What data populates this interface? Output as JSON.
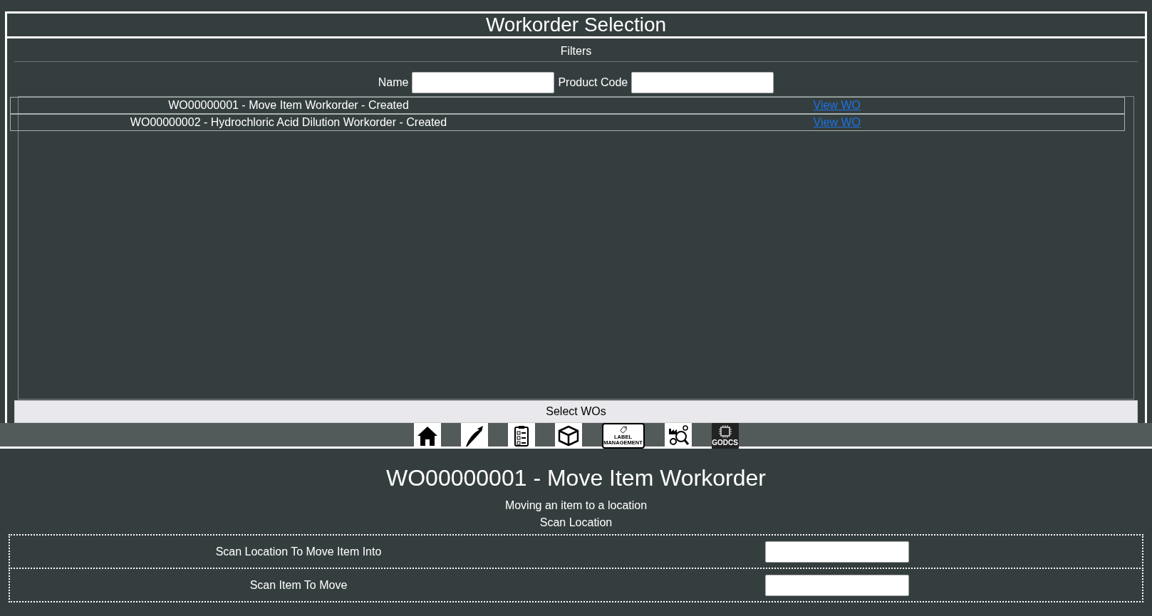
{
  "selection_panel": {
    "title": "Workorder Selection",
    "filters_heading": "Filters",
    "filters": [
      {
        "label": "Name"
      },
      {
        "label": "Product Code"
      }
    ],
    "workorders": [
      {
        "text": "WO00000001 - Move Item Workorder - Created",
        "link": "View WO"
      },
      {
        "text": "WO00000002 - Hydrochloric Acid Dilution Workorder - Created",
        "link": "View WO"
      }
    ],
    "select_button": "Select WOs"
  },
  "toolbar": [
    {
      "kind": "home"
    },
    {
      "kind": "quill"
    },
    {
      "kind": "checklist"
    },
    {
      "kind": "box"
    },
    {
      "kind": "label",
      "label": "LABEL MANAGEMENT"
    },
    {
      "kind": "factory"
    },
    {
      "kind": "chip",
      "label": "GODCS"
    }
  ],
  "workorder": {
    "title": "WO00000001 - Move Item Workorder",
    "description": "Moving an item to a location",
    "step": "Scan Location",
    "fields": [
      {
        "label": "Scan Location To Move Item Into"
      },
      {
        "label": "Scan Item To Move"
      }
    ]
  }
}
